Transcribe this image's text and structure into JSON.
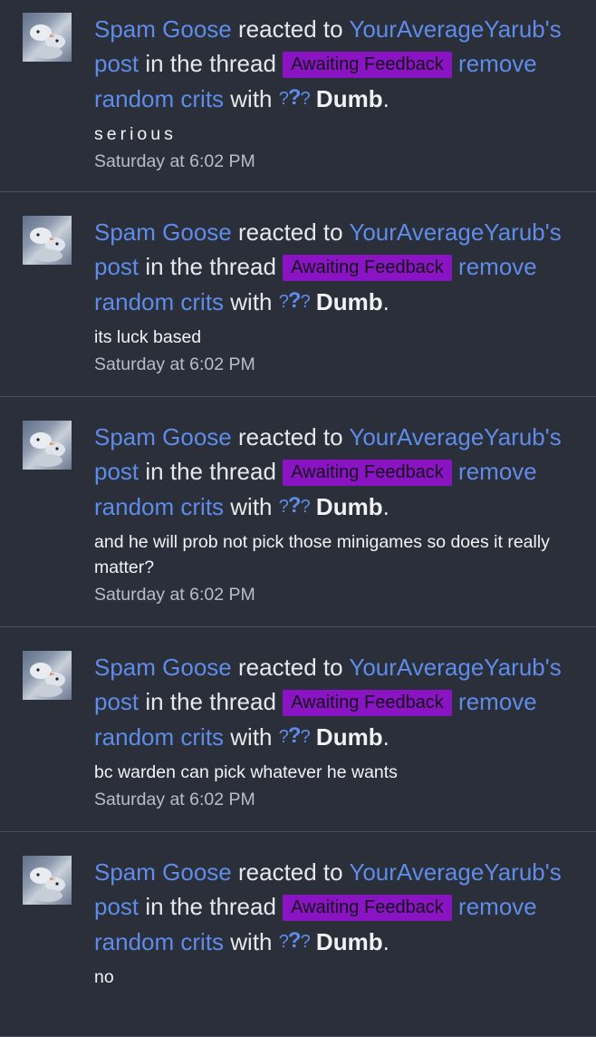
{
  "alerts": [
    {
      "user": "Spam Goose",
      "verb": "reacted to",
      "target_user": "YourAverageYarub's",
      "post_word": "post",
      "in_thread": "in the thread",
      "prefix_label": "Awaiting Feedback",
      "thread_line1": "remove",
      "thread_line2": "random crits",
      "with_word": "with",
      "reaction": "Dumb",
      "snippet": "serious",
      "time": "Saturday at 6:02 PM"
    },
    {
      "user": "Spam Goose",
      "verb": "reacted to",
      "target_user": "YourAverageYarub's",
      "post_word": "post",
      "in_thread": "in the thread",
      "prefix_label": "Awaiting Feedback",
      "thread_line1": "remove",
      "thread_line2": "random crits",
      "with_word": "with",
      "reaction": "Dumb",
      "snippet": "its luck based",
      "time": "Saturday at 6:02 PM"
    },
    {
      "user": "Spam Goose",
      "verb": "reacted to",
      "target_user": "YourAverageYarub's",
      "post_word": "post",
      "in_thread": "in the thread",
      "prefix_label": "Awaiting Feedback",
      "thread_line1": "remove",
      "thread_line2": "random crits",
      "with_word": "with",
      "reaction": "Dumb",
      "snippet": "and he will prob not pick those minigames so does it really matter?",
      "time": "Saturday at 6:02 PM"
    },
    {
      "user": "Spam Goose",
      "verb": "reacted to",
      "target_user": "YourAverageYarub's",
      "post_word": "post",
      "in_thread": "in the thread",
      "prefix_label": "Awaiting Feedback",
      "thread_line1": "remove",
      "thread_line2": "random crits",
      "with_word": "with",
      "reaction": "Dumb",
      "snippet": "bc warden can pick whatever he wants",
      "time": "Saturday at 6:02 PM"
    },
    {
      "user": "Spam Goose",
      "verb": "reacted to",
      "target_user": "YourAverageYarub's",
      "post_word": "post",
      "in_thread": "in the thread",
      "prefix_label": "Awaiting Feedback",
      "thread_line1": "remove",
      "thread_line2": "random crits",
      "with_word": "with",
      "reaction": "Dumb",
      "snippet": "no",
      "time": ""
    }
  ],
  "icons": {
    "avatar": "goose-avatar-image",
    "reaction": "question-marks-icon"
  },
  "colors": {
    "background": "#2b2f3a",
    "link": "#5e8ce8",
    "label_bg": "#8a13c4",
    "divider": "#4b5060",
    "muted_text": "#b9bdc6"
  }
}
